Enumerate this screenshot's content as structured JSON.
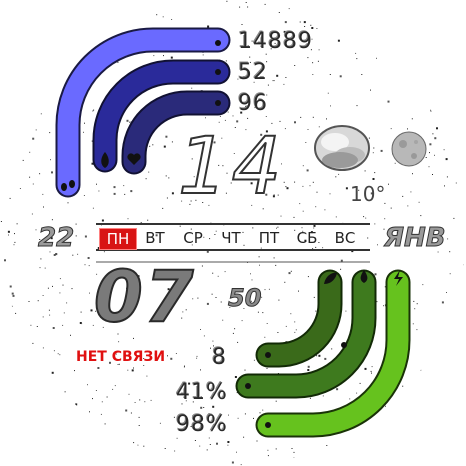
{
  "steps": "14889",
  "heart_rate": "52",
  "calories": "96",
  "hour": "14",
  "minutes": "07",
  "seconds": "50",
  "temperature": "10°",
  "date_day": "22",
  "month": "ЯНВ",
  "weekdays": [
    "ПН",
    "ВТ",
    "СР",
    "ЧТ",
    "ПТ",
    "СБ",
    "ВС"
  ],
  "active_weekday_index": 0,
  "connection_status": "НЕТ СВЯЗИ",
  "stat_bottom_1": "8",
  "stat_bottom_2": "41%",
  "stat_bottom_3": "98%",
  "top_arc_levels": [
    1.0,
    1.0,
    1.0
  ],
  "bottom_arc_levels": [
    1.0,
    1.0,
    1.0
  ],
  "icons": {
    "top_arcs": [
      "steps-icon",
      "flame-icon",
      "heart-icon"
    ],
    "bottom_arcs": [
      "leaf-icon",
      "drop-icon",
      "bolt-icon"
    ],
    "weather": "cloudy-moon-weather-icon",
    "moon_phase": "moon-phase-icon"
  },
  "colors": {
    "arc_blue_outer": "#6a6aff",
    "arc_blue_mid": "#2a2a9a",
    "arc_blue_inner": "#2a2a7a",
    "arc_green_outer": "#66c21e",
    "arc_green_mid": "#3e7a1e",
    "arc_green_inner": "#3a6a1a",
    "active_day": "#d81414",
    "status_text": "#e01010"
  }
}
